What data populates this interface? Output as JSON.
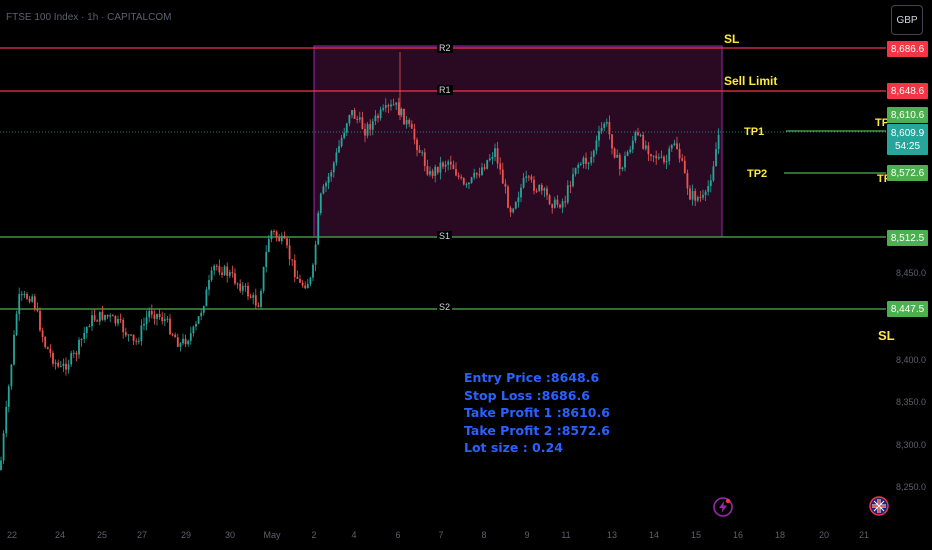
{
  "header": {
    "title": "FTSE 100 Index · 1h · CAPITALCOM",
    "currency_button": "GBP"
  },
  "colors": {
    "background": "#000000",
    "bull": "#26a69a",
    "bear": "#ef5350",
    "sl_line": "#f23645",
    "support_line": "#4caf50",
    "zone_fill": "#2a0a22",
    "zone_border": "#9c27b0",
    "label_yellow": "#ffeb3b",
    "info_blue": "#2962ff"
  },
  "levels": {
    "sl": {
      "label": "SL",
      "value": "8,686.6"
    },
    "sell_limit": {
      "label": "Sell Limit",
      "value": "8,648.6"
    },
    "tp1": {
      "label": "TP1",
      "value": "8,610.6"
    },
    "last_price": {
      "value": "8,609.9",
      "countdown": "54:25"
    },
    "tp2": {
      "label": "TP2",
      "value": "8,572.6"
    },
    "s1": {
      "label": "S1",
      "value": "8,512.5"
    },
    "s2": {
      "label": "S2",
      "value": "8,447.5"
    },
    "r1": {
      "label": "R1"
    },
    "r2": {
      "label": "R2"
    }
  },
  "edge_labels": {
    "tp_a": "TP",
    "tp_b": "TP",
    "sl_b": "SL"
  },
  "info_box": {
    "line1": "Entry Price :8648.6",
    "line2": "Stop Loss :8686.6",
    "line3": "Take Profit 1 :8610.6",
    "line4": "Take Profit 2 :8572.6",
    "line5": "Lot size : 0.24"
  },
  "x_axis": {
    "labels": [
      "22",
      "24",
      "25",
      "27",
      "29",
      "30",
      "May",
      "2",
      "4",
      "6",
      "7",
      "8",
      "9",
      "11",
      "13",
      "14",
      "15",
      "16",
      "18",
      "20",
      "21"
    ]
  },
  "y_axis": {
    "labels": [
      "8,450.0",
      "8,400.0",
      "8,350.0",
      "8,300.0",
      "8,250.0"
    ]
  },
  "icons": {
    "alert": "lightning-bolt-icon",
    "flag": "uk-flag-icon"
  }
}
